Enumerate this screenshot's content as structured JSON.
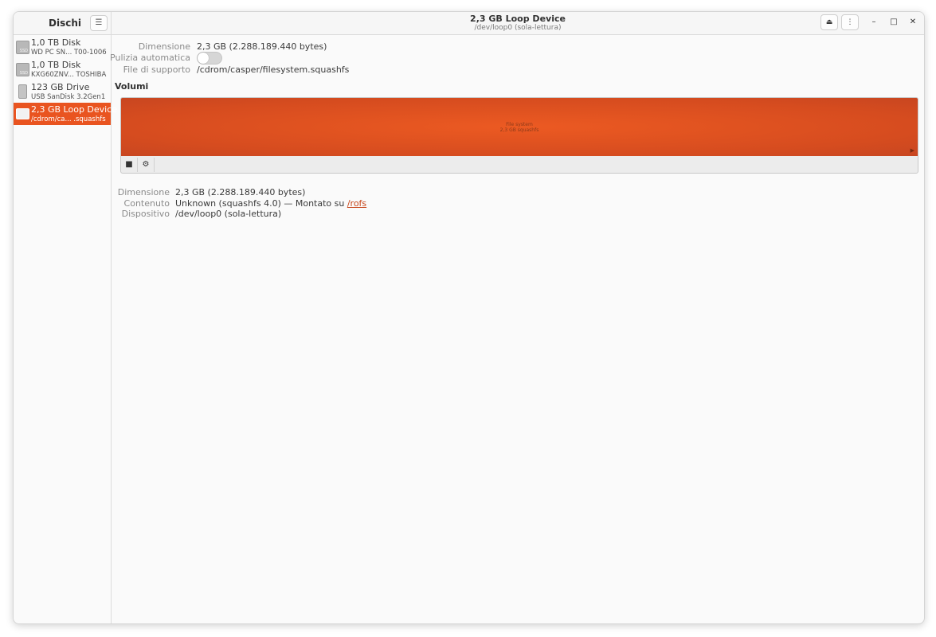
{
  "sidebar": {
    "title": "Dischi",
    "menu_icon": "hamburger-menu-icon",
    "items": [
      {
        "name": "1,0 TB Disk",
        "sub": "WD PC SN...  T00-1006",
        "icon": "ssd-icon",
        "icon_label": "SSD"
      },
      {
        "name": "1,0 TB Disk",
        "sub": "KXG60ZNV...  TOSHIBA",
        "icon": "ssd-icon",
        "icon_label": "SSD"
      },
      {
        "name": "123 GB Drive",
        "sub": "USB SanDisk 3.2Gen1",
        "icon": "usb-drive-icon"
      },
      {
        "name": "2,3 GB Loop Device",
        "sub": "/cdrom/ca...  .squashfs",
        "icon": "loop-device-icon",
        "selected": true
      }
    ]
  },
  "header": {
    "title": "2,3 GB Loop Device",
    "subtitle": "/dev/loop0 (sola-lettura)",
    "eject_glyph": "⏏",
    "more_glyph": "⋮",
    "minimize_glyph": "–",
    "maximize_glyph": "□",
    "close_glyph": "✕"
  },
  "device": {
    "size_label": "Dimensione",
    "size_value": "2,3 GB (2.288.189.440 bytes)",
    "autoclear_label": "Pulizia automatica",
    "autoclear_on": false,
    "backing_label": "File di supporto",
    "backing_value": "/cdrom/casper/filesystem.squashfs"
  },
  "volumes": {
    "title": "Volumi",
    "bar_label_1": "File system",
    "bar_label_2": "2,3 GB squashfs",
    "arrow_glyph": "▶",
    "stop_glyph": "■",
    "gear_glyph": "⚙",
    "accent_color": "#e95420"
  },
  "selected_volume": {
    "size_label": "Dimensione",
    "size_value": "2,3 GB (2.288.189.440 bytes)",
    "content_label": "Contenuto",
    "content_value": "Unknown (squashfs 4.0) — Montato su ",
    "mount_link": "/rofs",
    "device_label": "Dispositivo",
    "device_value": "/dev/loop0 (sola-lettura)"
  }
}
